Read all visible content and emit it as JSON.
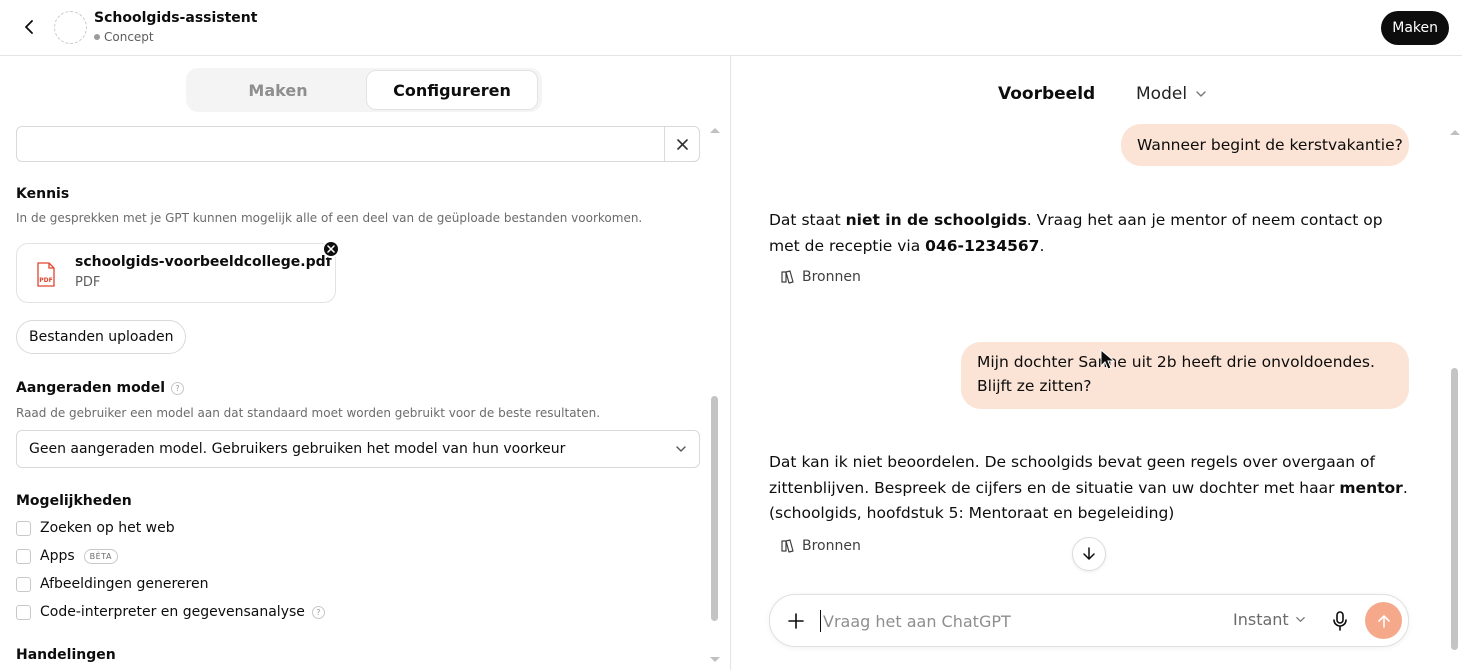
{
  "header": {
    "back_icon": "chevron-left-icon",
    "title": "Schoolgids-assistent",
    "status": "Concept",
    "make_button": "Maken"
  },
  "tabs": {
    "make": "Maken",
    "configure": "Configureren",
    "active": "Configureren"
  },
  "config": {
    "conversation_starter_value": "",
    "clear_icon": "close-icon",
    "knowledge": {
      "title": "Kennis",
      "description": "In de gesprekken met je GPT kunnen mogelijk alle of een deel van de geüploade bestanden voorkomen.",
      "file": {
        "name": "schoolgids-voorbeeldcollege.pdf",
        "type": "PDF",
        "icon_label": "PDF"
      },
      "upload_button": "Bestanden uploaden"
    },
    "recommended_model": {
      "title": "Aangeraden model",
      "help": "?",
      "description": "Raad de gebruiker een model aan dat standaard moet worden gebruikt voor de beste resultaten.",
      "selected": "Geen aangeraden model. Gebruikers gebruiken het model van hun voorkeur"
    },
    "capabilities": {
      "title": "Mogelijkheden",
      "items": [
        {
          "label": "Zoeken op het web",
          "checked": false
        },
        {
          "label": "Apps",
          "badge": "BÈTA",
          "checked": false
        },
        {
          "label": "Afbeeldingen genereren",
          "checked": false
        },
        {
          "label": "Code-interpreter en gegevensanalyse",
          "help": "?",
          "checked": false
        }
      ]
    },
    "actions": {
      "title": "Handelingen"
    }
  },
  "preview": {
    "title": "Voorbeeld",
    "model_label": "Model",
    "messages": [
      {
        "role": "user",
        "text": "Wanneer begint de kerstvakantie?"
      },
      {
        "role": "assistant",
        "parts": [
          "Dat staat ",
          "niet in de schoolgids",
          ". Vraag het aan je mentor of neem contact op met de receptie via ",
          "046-1234567",
          "."
        ],
        "sources": "Bronnen"
      },
      {
        "role": "user",
        "text": "Mijn dochter Sanne uit 2b heeft drie onvoldoendes. Blijft ze zitten?"
      },
      {
        "role": "assistant",
        "parts": [
          "Dat kan ik niet beoordelen. De schoolgids bevat geen regels over overgaan of zittenblijven. Bespreek de cijfers en de situatie van uw dochter met haar ",
          "mentor",
          ". (schoolgids, hoofdstuk 5: Mentoraat en begeleiding)"
        ],
        "sources": "Bronnen"
      }
    ],
    "composer": {
      "placeholder": "Vraag het aan ChatGPT",
      "mode": "Instant",
      "send_color": "#f5a98a"
    }
  },
  "colors": {
    "user_bubble": "#fbe3d5",
    "primary_button": "#0d0d0d"
  }
}
